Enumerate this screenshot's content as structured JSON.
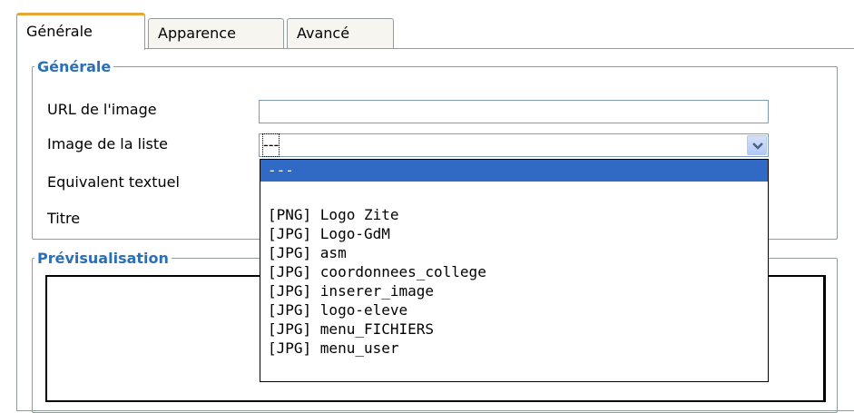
{
  "tabs": [
    {
      "label": "Générale",
      "active": true
    },
    {
      "label": "Apparence",
      "active": false
    },
    {
      "label": "Avancé",
      "active": false
    }
  ],
  "general": {
    "legend": "Générale",
    "url_label": "URL de l'image",
    "url_value": "",
    "list_label": "Image de la liste",
    "list_selected": "---",
    "alt_label": "Equivalent textuel",
    "title_label": "Titre"
  },
  "dropdown": {
    "options": [
      "---",
      "",
      "[PNG] Logo Zite",
      "[JPG] Logo-GdM",
      "[JPG] asm",
      "[JPG] coordonnees_college",
      "[JPG] inserer_image",
      "[JPG] logo-eleve",
      "[JPG] menu_FICHIERS",
      "[JPG] menu_user"
    ]
  },
  "preview": {
    "legend": "Prévisualisation"
  },
  "colors": {
    "accent_tab": "#e8a534",
    "legend_text": "#2b6fb6",
    "selection": "#316ac5"
  },
  "icons": {
    "select_arrow": "chevron-down-icon"
  }
}
